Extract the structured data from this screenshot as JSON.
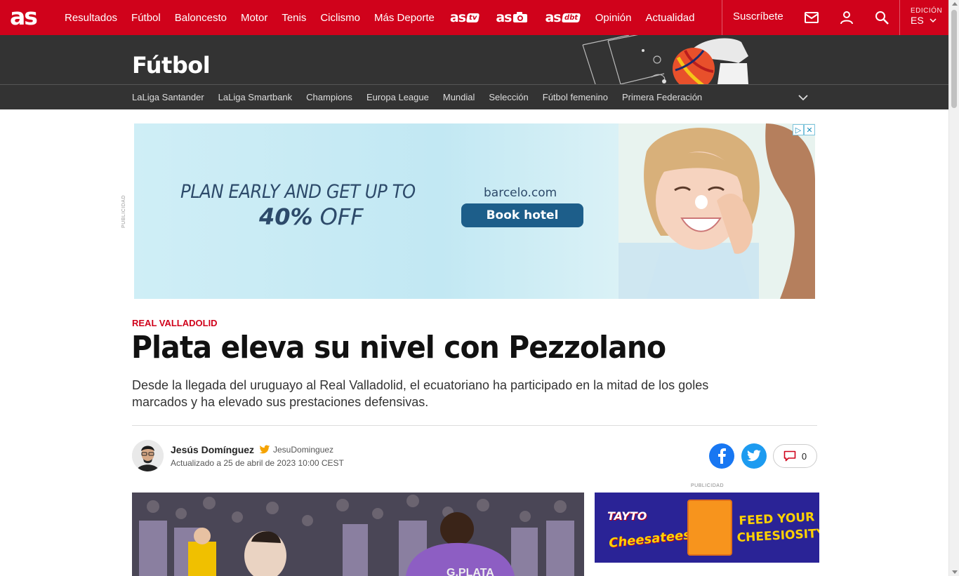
{
  "brand": {
    "logo": "as",
    "accent": "#d0021b"
  },
  "topnav": {
    "items": [
      "Resultados",
      "Fútbol",
      "Baloncesto",
      "Motor",
      "Tenis",
      "Ciclismo",
      "Más Deporte"
    ],
    "brands": [
      {
        "main": "as",
        "sub": "tv"
      },
      {
        "main": "as",
        "sub": "foto"
      },
      {
        "main": "as",
        "sub": "dbt"
      }
    ],
    "items_after": [
      "Opinión",
      "Actualidad"
    ],
    "subscribe": "Suscríbete",
    "edition_label": "EDICIÓN",
    "edition_value": "ES",
    "icons": [
      "mail-icon",
      "user-icon",
      "search-icon",
      "chevron-down-icon"
    ]
  },
  "section": {
    "title": "Fútbol",
    "subnav": [
      "LaLiga Santander",
      "LaLiga Smartbank",
      "Champions",
      "Europa League",
      "Mundial",
      "Selección",
      "Fútbol femenino",
      "Primera Federación"
    ]
  },
  "ad_top": {
    "label": "PUBLICIDAD",
    "line1": "PLAN EARLY AND GET UP TO",
    "percent": "40%",
    "off": "OFF",
    "url": "barcelo.com",
    "cta": "Book hotel"
  },
  "article": {
    "kicker": "REAL VALLADOLID",
    "headline": "Plata eleva su nivel con Pezzolano",
    "standfirst": "Desde la llegada del uruguayo al Real Valladolid, el ecuatoriano ha participado en la mitad de los goles marcados y ha elevado sus prestaciones defensivas.",
    "author": "Jesús Domínguez",
    "twitter": "JesuDominguez",
    "updated": "Actualizado a 25 de abril de 2023 10:00 CEST",
    "comments": "0"
  },
  "ad_side": {
    "label": "PUBLICIDAD",
    "brand1": "TAYTO",
    "brand2": "Cheesatees",
    "slogan": "FEED YOUR CHEESIOSITY"
  }
}
